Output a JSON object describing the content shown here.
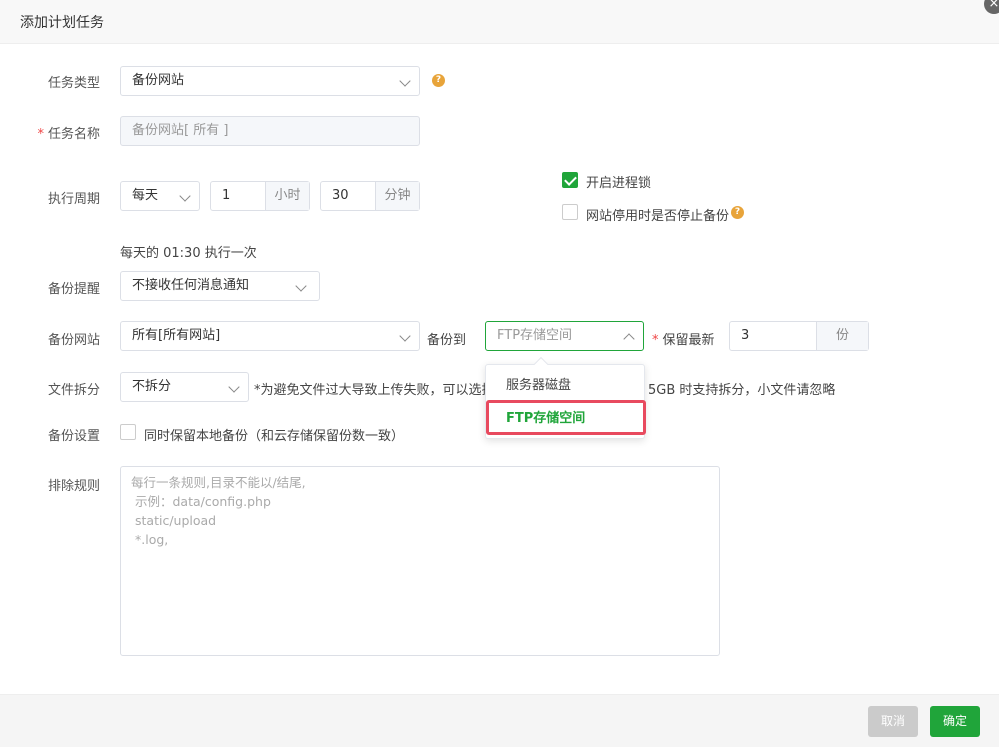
{
  "dialog": {
    "title": "添加计划任务",
    "close_symbol": "×"
  },
  "form": {
    "task_type": {
      "label": "任务类型",
      "value": "备份网站"
    },
    "task_name": {
      "label": "任务名称",
      "required_mark": "*",
      "value": "备份网站[ 所有 ]"
    },
    "period": {
      "label": "执行周期",
      "frequency": "每天",
      "hour_value": "1",
      "hour_unit": "小时",
      "minute_value": "30",
      "minute_unit": "分钟",
      "summary": "每天的 01:30 执行一次"
    },
    "process_lock": {
      "label": "开启进程锁",
      "checked": true
    },
    "stop_backup": {
      "label": "网站停用时是否停止备份",
      "checked": false
    },
    "backup_alert": {
      "label": "备份提醒",
      "value": "不接收任何消息通知"
    },
    "backup_site": {
      "label": "备份网站",
      "value": "所有[所有网站]",
      "backup_to_label": "备份到",
      "backup_to_value": "FTP存储空间",
      "keep_label": "保留最新",
      "keep_required": "*",
      "keep_value": "3",
      "keep_unit": "份"
    },
    "file_split": {
      "label": "文件拆分",
      "value": "不拆分",
      "note_left": "*为避免文件过大导致上传失败，可以选择拆",
      "note_right": "5GB 时支持拆分，小文件请忽略"
    },
    "backup_settings": {
      "label": "备份设置",
      "option": "同时保留本地备份（和云存储保留份数一致）"
    },
    "exclude_rules": {
      "label": "排除规则",
      "placeholder_lines": [
        "每行一条规则,目录不能以/结尾,",
        " 示例：data/config.php",
        " static/upload",
        " *.log,"
      ]
    }
  },
  "dropdown": {
    "options": [
      "服务器磁盘",
      "FTP存储空间"
    ],
    "selected": "FTP存储空间"
  },
  "footer": {
    "cancel": "取消",
    "confirm": "确定"
  },
  "colors": {
    "accent": "#20a53a",
    "highlight": "#e84a5f",
    "help_icon": "#e8a43a"
  }
}
